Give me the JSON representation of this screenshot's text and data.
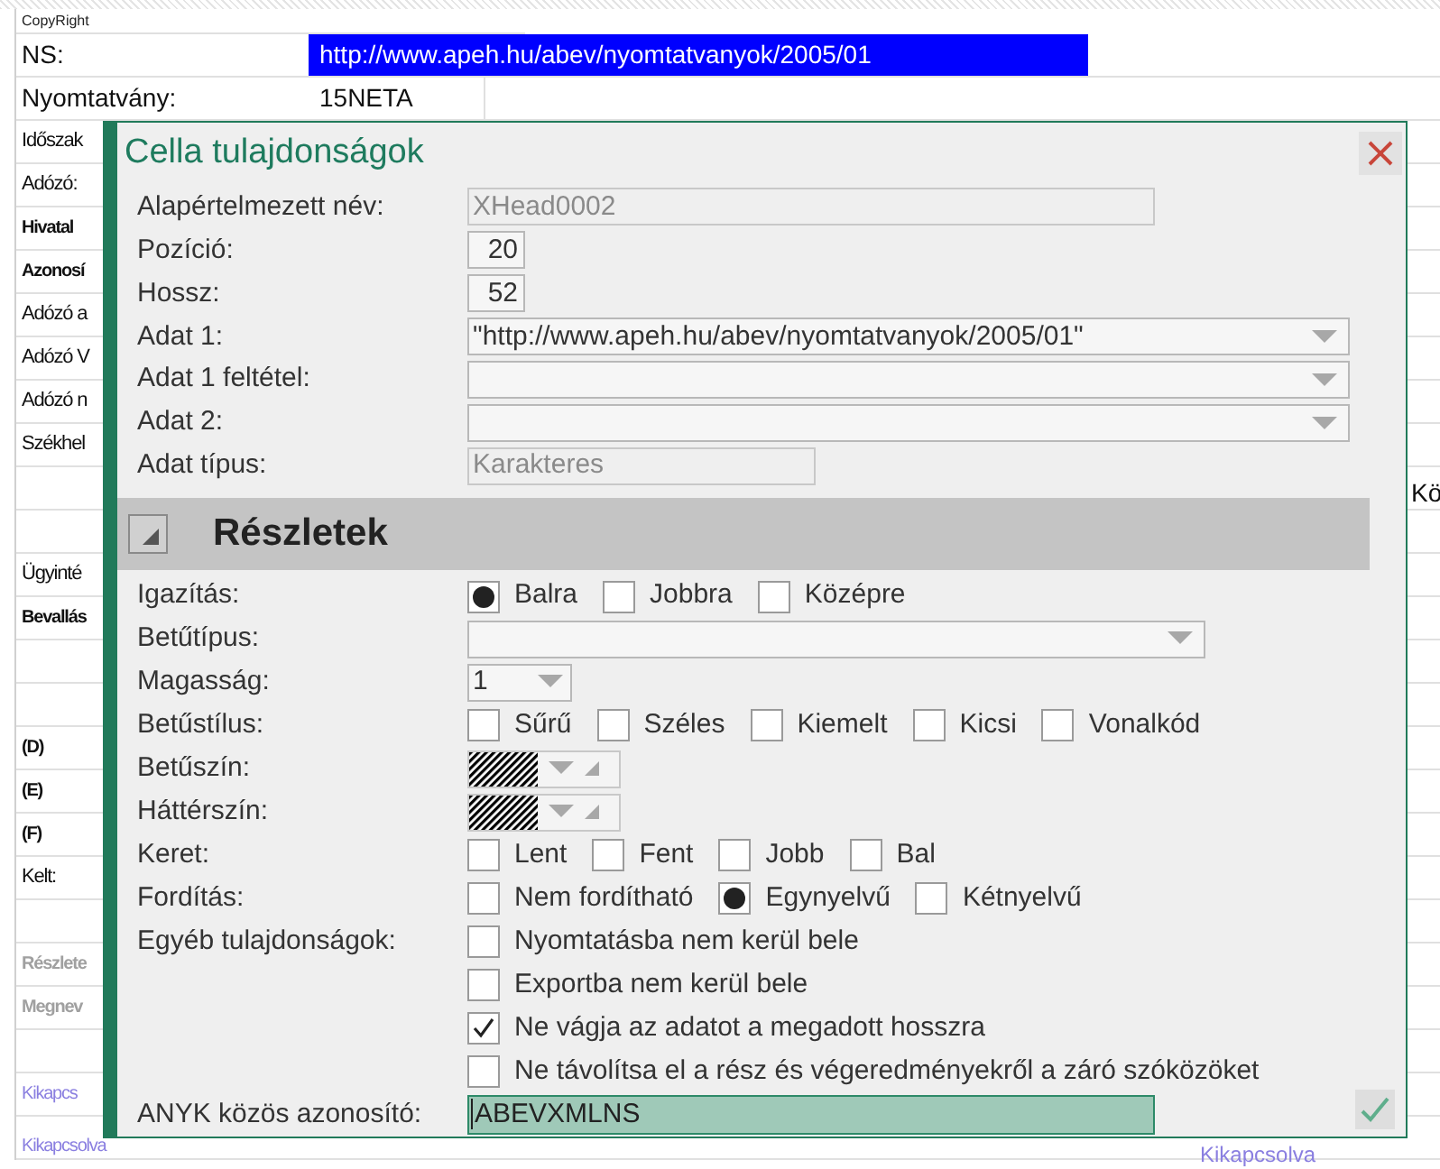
{
  "sheet": {
    "rows": [
      {
        "label": "CopyRight",
        "kind": "tiny"
      },
      {
        "label": "NS:",
        "kind": "header",
        "value": "http://www.apeh.hu/abev/nyomtatvanyok/2005/01",
        "highlighted": true
      },
      {
        "label": "Nyomtatvány:",
        "kind": "header",
        "value": "15NETA",
        "highlighted": false
      },
      {
        "label": "Időszak",
        "kind": "normal"
      },
      {
        "label": "Adózó:",
        "kind": "normal"
      },
      {
        "label": "Hivatal",
        "kind": "bold"
      },
      {
        "label": "Azonosí",
        "kind": "bold"
      },
      {
        "label": "Adózó a",
        "kind": "normal"
      },
      {
        "label": "Adózó V",
        "kind": "normal"
      },
      {
        "label": "Adózó n",
        "kind": "normal"
      },
      {
        "label": "Székhel",
        "kind": "normal"
      },
      {
        "kind": "blank"
      },
      {
        "kind": "blank"
      },
      {
        "label": "Ügyinté",
        "kind": "normal"
      },
      {
        "label": "Bevallás",
        "kind": "bold"
      },
      {
        "kind": "blank"
      },
      {
        "kind": "blank"
      },
      {
        "label": "(D)",
        "kind": "bold"
      },
      {
        "label": "(E)",
        "kind": "bold"
      },
      {
        "label": "(F)",
        "kind": "bold"
      },
      {
        "label": "Kelt:",
        "kind": "normal"
      },
      {
        "kind": "blank"
      },
      {
        "label": "Részlete",
        "kind": "muted"
      },
      {
        "label": "Megnev",
        "kind": "muted"
      },
      {
        "kind": "blank"
      },
      {
        "label": "Kikapcs",
        "kind": "off"
      },
      {
        "label": "Kikapcsolva",
        "kind": "off"
      }
    ],
    "right_texts": [
      {
        "text": "Kö",
        "kind": "normal"
      },
      {
        "text": "Kikapcsolva",
        "kind": "off"
      }
    ]
  },
  "dialog": {
    "title": "Cella tulajdonságok",
    "fields": [
      {
        "label": "Alapértelmezett név:",
        "kind": "readonly",
        "value": "XHead0002"
      },
      {
        "label": "Pozíció:",
        "kind": "number",
        "value": "20"
      },
      {
        "label": "Hossz:",
        "kind": "number",
        "value": "52"
      },
      {
        "label": "Adat 1:",
        "kind": "dropdown",
        "value": "\"http://www.apeh.hu/abev/nyomtatvanyok/2005/01\""
      },
      {
        "label": "Adat 1 feltétel:",
        "kind": "dropdown"
      },
      {
        "label": "Adat 2:",
        "kind": "dropdown"
      },
      {
        "label": "Adat típus:",
        "kind": "readonly_short",
        "value": "Karakteres"
      }
    ],
    "section": {
      "title": "Részletek",
      "expanded": true
    },
    "details": [
      {
        "label": "Igazítás:",
        "kind": "radios",
        "options": [
          {
            "label": "Balra",
            "selected": true
          },
          {
            "label": "Jobbra",
            "selected": false
          },
          {
            "label": "Középre",
            "selected": false
          }
        ]
      },
      {
        "label": "Betűtípus:",
        "kind": "dropdown"
      },
      {
        "label": "Magasság:",
        "kind": "small_dropdown",
        "value": "1"
      },
      {
        "label": "Betűstílus:",
        "kind": "checks",
        "options": [
          {
            "label": "Sűrű",
            "checked": false
          },
          {
            "label": "Széles",
            "checked": false
          },
          {
            "label": "Kiemelt",
            "checked": false
          },
          {
            "label": "Kicsi",
            "checked": false
          },
          {
            "label": "Vonalkód",
            "checked": false
          }
        ]
      },
      {
        "label": "Betűszín:",
        "kind": "color"
      },
      {
        "label": "Háttérszín:",
        "kind": "color"
      },
      {
        "label": "Keret:",
        "kind": "checks",
        "options": [
          {
            "label": "Lent",
            "checked": false
          },
          {
            "label": "Fent",
            "checked": false
          },
          {
            "label": "Jobb",
            "checked": false
          },
          {
            "label": "Bal",
            "checked": false
          }
        ]
      },
      {
        "label": "Fordítás:",
        "kind": "radios",
        "options": [
          {
            "label": "Nem fordítható",
            "selected": false
          },
          {
            "label": "Egynyelvű",
            "selected": true
          },
          {
            "label": "Kétnyelvű",
            "selected": false
          }
        ]
      },
      {
        "label": "Egyéb tulajdonságok:",
        "kind": "check_column",
        "options": [
          {
            "label": "Nyomtatásba nem kerül bele",
            "checked": false
          },
          {
            "label": "Exportba nem kerül bele",
            "checked": false
          },
          {
            "label": "Ne vágja az adatot a megadott hosszra",
            "checked": true
          },
          {
            "label": "Ne távolítsa el a rész és végeredményekről a záró szóközöket",
            "checked": false
          }
        ]
      },
      {
        "label": "ANYK közös azonosító:",
        "kind": "focused_text",
        "value": "ABEVXMLNS"
      }
    ]
  }
}
